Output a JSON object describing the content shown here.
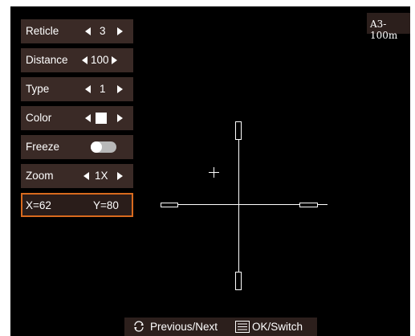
{
  "menu": {
    "reticle": {
      "label": "Reticle",
      "value": "3"
    },
    "distance": {
      "label": "Distance",
      "value": "100"
    },
    "type": {
      "label": "Type",
      "value": "1"
    },
    "color": {
      "label": "Color",
      "value": "white"
    },
    "freeze": {
      "label": "Freeze",
      "state": "off"
    },
    "zoom": {
      "label": "Zoom",
      "value": "1X"
    },
    "coords": {
      "x": "X=62",
      "y": "Y=80"
    }
  },
  "range_tag": "A3-100m",
  "bottom_bar": {
    "prev_next_icon": "rotate-icon",
    "prev_next_label": "Previous/Next",
    "ok_icon": "menu-icon",
    "ok_label": "OK/Switch"
  },
  "colors": {
    "highlight_border": "#d86a1e",
    "menu_bg": "#3a2a26",
    "screen_bg": "#000000"
  }
}
